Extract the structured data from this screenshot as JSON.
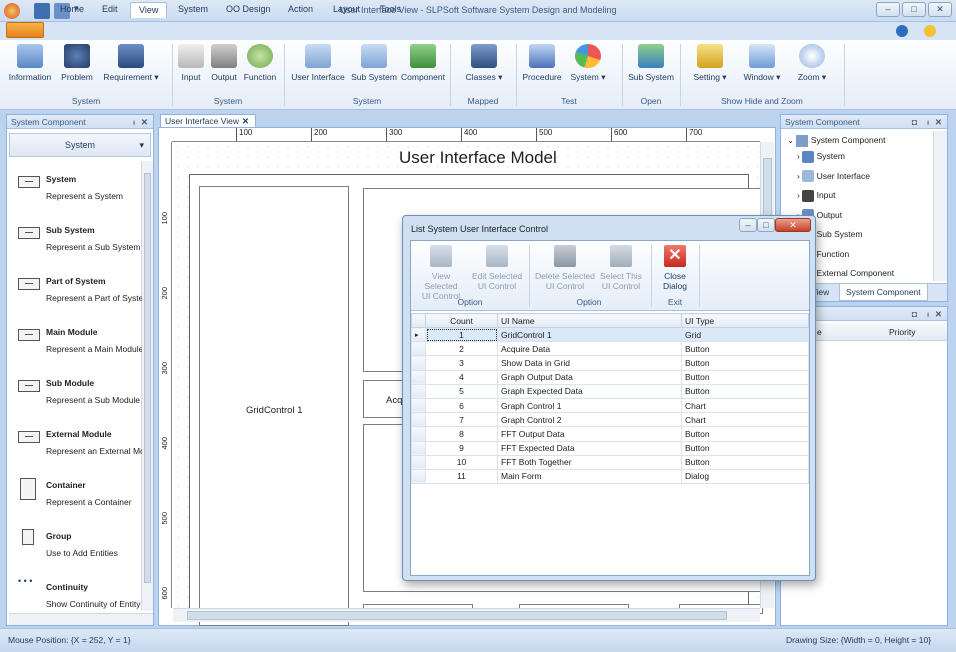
{
  "window": {
    "title": "User Interface View - SLPSoft Software System Design and Modeling"
  },
  "tabs": [
    "Home",
    "Edit",
    "View",
    "System",
    "OO Design",
    "Action",
    "Layout",
    "Tools"
  ],
  "ribbon": {
    "groups": [
      {
        "label": "System",
        "buttons": [
          "Information",
          "Problem",
          "Requirement ▾"
        ]
      },
      {
        "label": "System",
        "buttons": [
          "Input",
          "Output",
          "Function"
        ]
      },
      {
        "label": "System",
        "buttons": [
          "User Interface",
          "Sub System",
          "Component"
        ]
      },
      {
        "label": "Mapped",
        "buttons": [
          "Classes ▾"
        ]
      },
      {
        "label": "Test",
        "buttons": [
          "Procedure",
          "System ▾"
        ]
      },
      {
        "label": "Open",
        "buttons": [
          "Sub System"
        ]
      },
      {
        "label": "Show Hide and Zoom",
        "buttons": [
          "Setting ▾",
          "Window ▾",
          "Zoom ▾"
        ]
      }
    ]
  },
  "left_pane": {
    "title": "System Component",
    "category": "System",
    "items": [
      {
        "name": "System",
        "desc": "Represent a System"
      },
      {
        "name": "Sub System",
        "desc": "Represent a Sub System"
      },
      {
        "name": "Part of System",
        "desc": "Represent a Part of Syste"
      },
      {
        "name": "Main Module",
        "desc": "Represent a Main Module"
      },
      {
        "name": "Sub Module",
        "desc": "Represent a Sub Module"
      },
      {
        "name": "External Module",
        "desc": "Represent an External Mo"
      },
      {
        "name": "Container",
        "desc": "Represent a Container"
      },
      {
        "name": "Group",
        "desc": "Use to Add Entities"
      },
      {
        "name": "Continuity",
        "desc": "Show Continuity of Entity"
      }
    ]
  },
  "doc": {
    "tab": "User Interface View",
    "ruler_marks": [
      "100",
      "200",
      "300",
      "400",
      "500",
      "600",
      "700"
    ],
    "vruler_marks": [
      "100",
      "200",
      "300",
      "400",
      "500",
      "600"
    ],
    "model_title": "User Interface Model",
    "grid_control_label": "GridControl 1",
    "acquire_label": "Acqui"
  },
  "right_pane": {
    "title": "System Component",
    "root": "System Component",
    "items": [
      "System",
      "User Interface",
      "Input",
      "Output",
      "Sub System",
      "Function",
      "External Component"
    ],
    "tabs": [
      "View",
      "System Component"
    ],
    "bottom_col_e": "e",
    "bottom_col_priority": "Priority"
  },
  "dialog": {
    "title": "List System User Interface Control",
    "buttons": [
      {
        "line1": "View Selected",
        "line2": "UI Control"
      },
      {
        "line1": "Edit Selected",
        "line2": "UI Control"
      },
      {
        "line1": "Delete Selected",
        "line2": "UI Control"
      },
      {
        "line1": "Select This",
        "line2": "UI Control"
      },
      {
        "line1": "Close",
        "line2": "Dialog"
      }
    ],
    "groups": [
      "Option",
      "Option",
      "Exit"
    ],
    "columns": [
      "Count",
      "UI Name",
      "UI Type"
    ],
    "rows": [
      [
        "1",
        "GridControl 1",
        "Grid"
      ],
      [
        "2",
        "Acquire Data",
        "Button"
      ],
      [
        "3",
        "Show Data in Grid",
        "Button"
      ],
      [
        "4",
        "Graph Output Data",
        "Button"
      ],
      [
        "5",
        "Graph Expected Data",
        "Button"
      ],
      [
        "6",
        "Graph Control 1",
        "Chart"
      ],
      [
        "7",
        "Graph Control 2",
        "Chart"
      ],
      [
        "8",
        "FFT Output Data",
        "Button"
      ],
      [
        "9",
        "FFT Expected Data",
        "Button"
      ],
      [
        "10",
        "FFT Both Together",
        "Button"
      ],
      [
        "11",
        "Main Form",
        "Dialog"
      ]
    ]
  },
  "status": {
    "mouse": "Mouse Position: {X = 252,  Y = 1}",
    "drawing": "Drawing Size: {Width = 0, Height = 10}"
  }
}
